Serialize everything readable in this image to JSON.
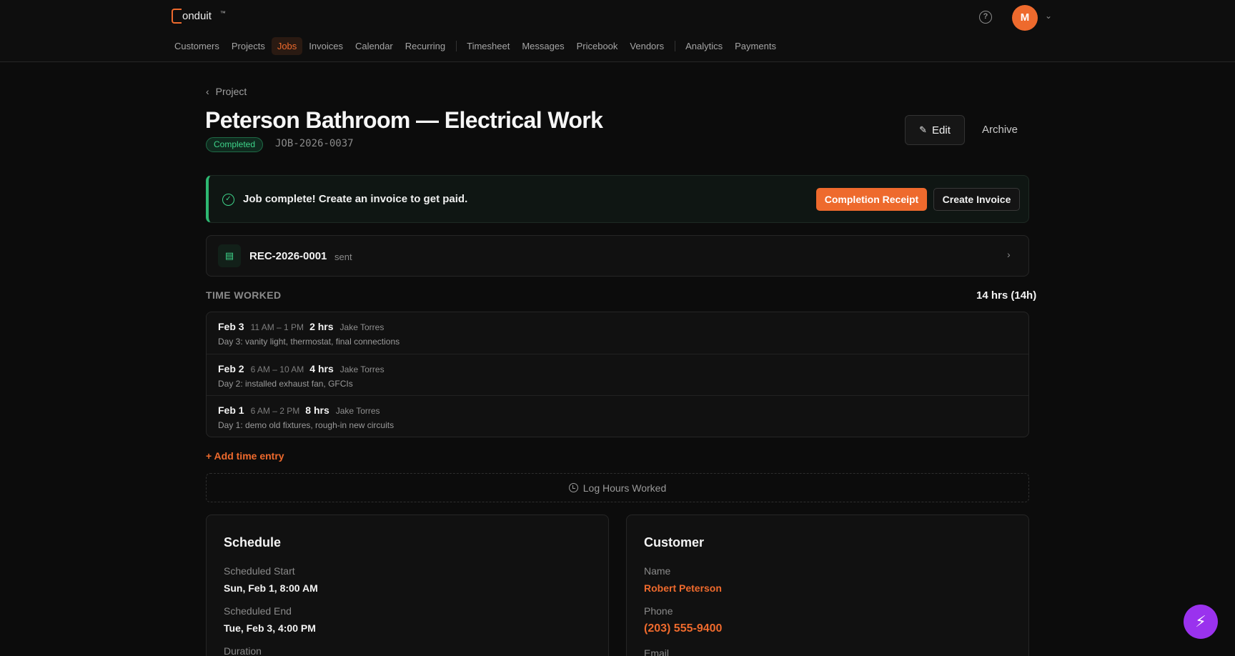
{
  "app": {
    "logo_text": "onduit",
    "logo_tm": "™"
  },
  "header": {
    "help_icon": "?",
    "avatar_initial": "M",
    "avatar_caret": "⌄"
  },
  "nav": {
    "items": [
      "Customers",
      "Projects",
      "Jobs",
      "Invoices",
      "Calendar",
      "Recurring",
      "Timesheet",
      "Messages",
      "Pricebook",
      "Vendors",
      "Analytics",
      "Payments"
    ],
    "active": "Jobs"
  },
  "breadcrumb": {
    "back_label": "Project"
  },
  "job": {
    "title": "Peterson Bathroom — Electrical Work",
    "status": "Completed",
    "number": "JOB-2026-0037",
    "edit_label": "Edit",
    "archive_label": "Archive"
  },
  "alert": {
    "text": "Job complete! Create an invoice to get paid.",
    "receipt_button": "Completion Receipt",
    "invoice_button": "Create Invoice"
  },
  "receipt": {
    "number": "REC-2026-0001",
    "status": "sent"
  },
  "time_worked": {
    "label": "TIME WORKED",
    "total": "14 hrs (14h)",
    "entries": [
      {
        "date": "Feb 3",
        "range": "11 AM – 1 PM",
        "hours": "2 hrs",
        "person": "Jake Torres",
        "note": "Day 3: vanity light, thermostat, final connections"
      },
      {
        "date": "Feb 2",
        "range": "6 AM – 10 AM",
        "hours": "4 hrs",
        "person": "Jake Torres",
        "note": "Day 2: installed exhaust fan, GFCIs"
      },
      {
        "date": "Feb 1",
        "range": "6 AM – 2 PM",
        "hours": "8 hrs",
        "person": "Jake Torres",
        "note": "Day 1: demo old fixtures, rough-in new circuits"
      }
    ],
    "add_label": "+ Add time entry",
    "log_label": "Log Hours Worked"
  },
  "schedule": {
    "title": "Schedule",
    "start_label": "Scheduled Start",
    "start_value": "Sun, Feb 1, 8:00 AM",
    "end_label": "Scheduled End",
    "end_value": "Tue, Feb 3, 4:00 PM",
    "duration_label": "Duration"
  },
  "customer": {
    "title": "Customer",
    "name_label": "Name",
    "name_value": "Robert Peterson",
    "phone_label": "Phone",
    "phone_value": "(203) 555-9400",
    "email_label": "Email"
  },
  "icons": {
    "help": "question-circle-icon",
    "back": "chevron-left-icon",
    "edit": "pencil-square-icon",
    "alert": "check-circle-icon",
    "receipt": "document-icon",
    "chevron": "chevron-right-icon",
    "clock": "clock-icon",
    "fab": "lightning-icon"
  },
  "colors": {
    "accent": "#ee6a2d",
    "success": "#3ed48a",
    "fab": "#9a32ee",
    "background": "#0c0c0c"
  }
}
